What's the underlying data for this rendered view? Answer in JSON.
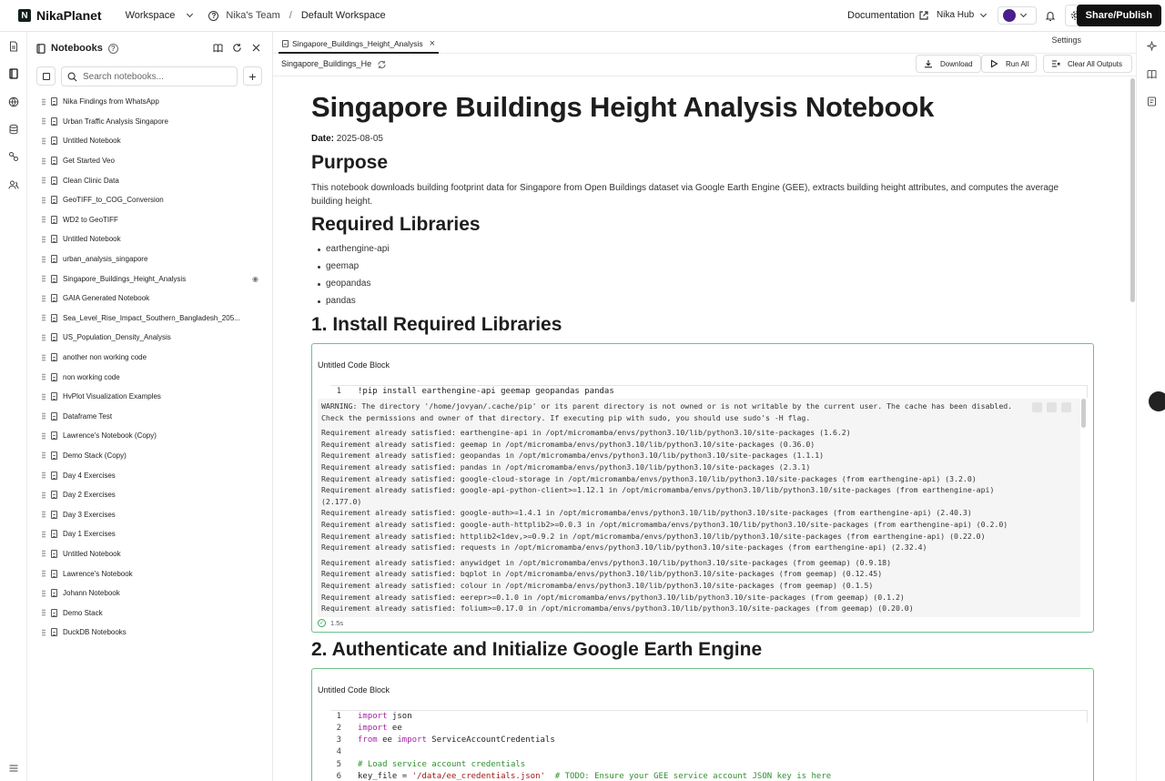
{
  "app": {
    "brand": "NikaPlanet",
    "workspace_label": "Workspace",
    "team": "Nika's Team",
    "separator": "/",
    "workspace_name": "Default Workspace",
    "documentation": "Documentation",
    "hub": "Nika Hub",
    "share_label": "Share/Publish",
    "settings_tooltip": "Settings"
  },
  "sidebar": {
    "title": "Notebooks",
    "search_placeholder": "Search notebooks...",
    "items": [
      {
        "label": "Nika Findings from WhatsApp"
      },
      {
        "label": "Urban Traffic Analysis Singapore"
      },
      {
        "label": "Untitled Notebook"
      },
      {
        "label": "Get Started Veo"
      },
      {
        "label": "Clean Clinic Data"
      },
      {
        "label": "GeoTIFF_to_COG_Conversion"
      },
      {
        "label": "WD2 to GeoTIFF"
      },
      {
        "label": "Untitled Notebook"
      },
      {
        "label": "urban_analysis_singapore"
      },
      {
        "label": "Singapore_Buildings_Height_Analysis"
      },
      {
        "label": "GAIA Generated Notebook"
      },
      {
        "label": "Sea_Level_Rise_Impact_Southern_Bangladesh_205..."
      },
      {
        "label": "US_Population_Density_Analysis"
      },
      {
        "label": "another non working code"
      },
      {
        "label": "non working code"
      },
      {
        "label": "HvPlot Visualization Examples"
      },
      {
        "label": "Dataframe Test"
      },
      {
        "label": "Lawrence's Notebook (Copy)"
      },
      {
        "label": "Demo Stack (Copy)"
      },
      {
        "label": "Day 4 Exercises"
      },
      {
        "label": "Day 2 Exercises"
      },
      {
        "label": "Day 3 Exercises"
      },
      {
        "label": "Day 1 Exercises"
      },
      {
        "label": "Untitled Notebook"
      },
      {
        "label": "Lawrence's Notebook"
      },
      {
        "label": "Johann Notebook"
      },
      {
        "label": "Demo Stack"
      },
      {
        "label": "DuckDB Notebooks"
      }
    ]
  },
  "tab": {
    "label": "Singapore_Buildings_Height_Analysis"
  },
  "toolbar": {
    "notebook_name": "Singapore_Buildings_He",
    "download": "Download",
    "run_all": "Run All",
    "clear_outputs": "Clear All Outputs"
  },
  "notebook": {
    "title": "Singapore Buildings Height Analysis Notebook",
    "date_label": "Date:",
    "date_value": "2025-08-05",
    "purpose_heading": "Purpose",
    "purpose_text": "This notebook downloads building footprint data for Singapore from Open Buildings dataset via Google Earth Engine (GEE), extracts building height attributes, and computes the average building height.",
    "libraries_heading": "Required Libraries",
    "libraries": [
      "earthengine-api",
      "geemap",
      "geopandas",
      "pandas"
    ],
    "section1_heading": "1. Install Required Libraries",
    "section2_heading": "2. Authenticate and Initialize Google Earth Engine",
    "cell1": {
      "title": "Untitled Code Block",
      "line_no": "1",
      "code": "!pip install earthengine-api geemap geopandas pandas",
      "status_time": "1.5s",
      "output_group1": [
        "WARNING: The directory '/home/jovyan/.cache/pip' or its parent directory is not owned or is not writable by the current user. The cache has been disabled.",
        "Check the permissions and owner of that directory. If executing pip with sudo, you should use sudo's -H flag."
      ],
      "output_group2": [
        "Requirement already satisfied: earthengine-api in /opt/micromamba/envs/python3.10/lib/python3.10/site-packages (1.6.2)",
        "Requirement already satisfied: geemap in /opt/micromamba/envs/python3.10/lib/python3.10/site-packages (0.36.0)",
        "Requirement already satisfied: geopandas in /opt/micromamba/envs/python3.10/lib/python3.10/site-packages (1.1.1)",
        "Requirement already satisfied: pandas in /opt/micromamba/envs/python3.10/lib/python3.10/site-packages (2.3.1)",
        "Requirement already satisfied: google-cloud-storage in /opt/micromamba/envs/python3.10/lib/python3.10/site-packages (from earthengine-api) (3.2.0)",
        "Requirement already satisfied: google-api-python-client>=1.12.1 in /opt/micromamba/envs/python3.10/lib/python3.10/site-packages (from earthengine-api)",
        "(2.177.0)",
        "Requirement already satisfied: google-auth>=1.4.1 in /opt/micromamba/envs/python3.10/lib/python3.10/site-packages (from earthengine-api) (2.40.3)",
        "Requirement already satisfied: google-auth-httplib2>=0.0.3 in /opt/micromamba/envs/python3.10/lib/python3.10/site-packages (from earthengine-api) (0.2.0)",
        "Requirement already satisfied: httplib2<1dev,>=0.9.2 in /opt/micromamba/envs/python3.10/lib/python3.10/site-packages (from earthengine-api) (0.22.0)",
        "Requirement already satisfied: requests in /opt/micromamba/envs/python3.10/lib/python3.10/site-packages (from earthengine-api) (2.32.4)"
      ],
      "output_group3": [
        "Requirement already satisfied: anywidget in /opt/micromamba/envs/python3.10/lib/python3.10/site-packages (from geemap) (0.9.18)",
        "Requirement already satisfied: bqplot in /opt/micromamba/envs/python3.10/lib/python3.10/site-packages (from geemap) (0.12.45)",
        "Requirement already satisfied: colour in /opt/micromamba/envs/python3.10/lib/python3.10/site-packages (from geemap) (0.1.5)",
        "Requirement already satisfied: eerepr>=0.1.0 in /opt/micromamba/envs/python3.10/lib/python3.10/site-packages (from geemap) (0.1.2)",
        "Requirement already satisfied: folium>=0.17.0 in /opt/micromamba/envs/python3.10/lib/python3.10/site-packages (from geemap) (0.20.0)"
      ]
    },
    "cell2": {
      "title": "Untitled Code Block",
      "lines": [
        {
          "n": "1",
          "kw": "import",
          "rest": " json",
          "kw2": "",
          "rest2": "",
          "str": "",
          "cm": ""
        },
        {
          "n": "2",
          "kw": "import",
          "rest": " ee",
          "kw2": "",
          "rest2": "",
          "str": "",
          "cm": ""
        },
        {
          "n": "3",
          "kw": "from",
          "rest": " ee ",
          "kw2": "import",
          "rest2": " ServiceAccountCredentials",
          "str": "",
          "cm": ""
        },
        {
          "n": "4",
          "kw": "",
          "rest": "",
          "kw2": "",
          "rest2": "",
          "str": "",
          "cm": ""
        },
        {
          "n": "5",
          "kw": "",
          "rest": "",
          "kw2": "",
          "rest2": "",
          "str": "",
          "cm": "# Load service account credentials"
        },
        {
          "n": "6",
          "kw": "",
          "rest": "key_file = ",
          "kw2": "",
          "rest2": "",
          "str": "'/data/ee_credentials.json'",
          "cm": "  # TODO: Ensure your GEE service account JSON key is here"
        }
      ]
    }
  },
  "colors": {
    "accent_green": "#6cc28a",
    "dark": "#111111",
    "avatar": "#4b1e8c"
  }
}
